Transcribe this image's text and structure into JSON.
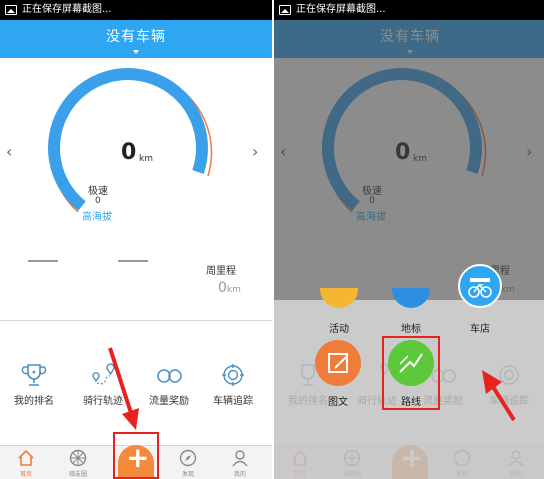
{
  "status_bar": {
    "text": "正在保存屏幕截图..."
  },
  "header": {
    "title": "没有车辆"
  },
  "gauge": {
    "speed_value": "0",
    "speed_unit": "km",
    "max_speed_label": "极速",
    "max_speed_value": "0",
    "altitude_label": "高海拔",
    "arc_color": "#3aa0ea",
    "outer_arc_color": "#f07c3c"
  },
  "weekly": {
    "label": "周里程",
    "value": "0",
    "unit": "km"
  },
  "features": [
    {
      "label": "我的排名",
      "icon": "trophy-icon"
    },
    {
      "label": "骑行轨迹",
      "icon": "route-pins-icon"
    },
    {
      "label": "流量奖励",
      "icon": "flow-reward-icon"
    },
    {
      "label": "车辆追踪",
      "icon": "vehicle-track-icon"
    }
  ],
  "bottom_nav": [
    {
      "label": "首页",
      "icon": "home-icon"
    },
    {
      "label": "骑友圈",
      "icon": "wheel-icon"
    },
    {
      "label": "",
      "icon": "plus-icon"
    },
    {
      "label": "发现",
      "icon": "compass-icon"
    },
    {
      "label": "我的",
      "icon": "person-icon"
    }
  ],
  "popup_menu": [
    {
      "label": "活动",
      "color": "#f5b731",
      "icon": "activity-icon"
    },
    {
      "label": "地标",
      "color": "#2e8fe0",
      "icon": "landmark-icon"
    },
    {
      "label": "车店",
      "color": "#2ea6f1",
      "icon": "bike-shop-icon"
    },
    {
      "label": "图文",
      "color": "#f07c3c",
      "icon": "edit-icon"
    },
    {
      "label": "路线",
      "color": "#5cc83a",
      "icon": "route-icon"
    }
  ],
  "colors": {
    "header": "#2ea6f1",
    "highlight": "#e7231f",
    "accent": "#f07c3c"
  }
}
